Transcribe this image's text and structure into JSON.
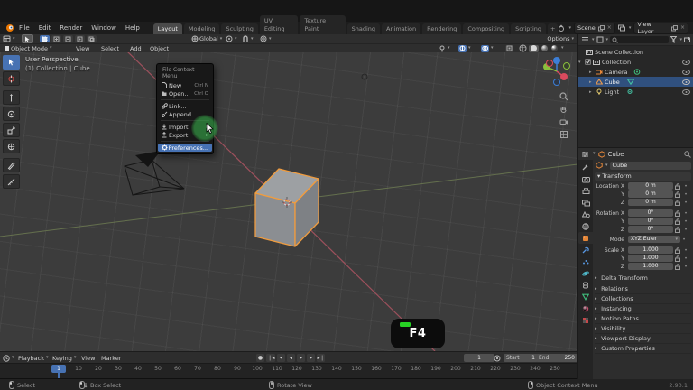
{
  "topbar": {
    "menus": [
      "File",
      "Edit",
      "Render",
      "Window",
      "Help"
    ],
    "tabs": [
      "Layout",
      "Modeling",
      "Sculpting",
      "UV Editing",
      "Texture Paint",
      "Shading",
      "Animation",
      "Rendering",
      "Compositing",
      "Scripting"
    ],
    "add_tab": "+",
    "scene": {
      "label": "Scene"
    },
    "view_layer": {
      "label": "View Layer"
    }
  },
  "tool_settings": {
    "orientation": "Global",
    "options_label": "Options"
  },
  "viewport": {
    "header": {
      "mode": "Object Mode",
      "menus": [
        "View",
        "Select",
        "Add",
        "Object"
      ]
    },
    "overlay": {
      "line1": "User Perspective",
      "line2": "(1) Collection | Cube"
    },
    "toolbar_tools": [
      "select-box",
      "cursor",
      "move",
      "rotate",
      "scale",
      "transform",
      "annotate",
      "measure"
    ],
    "keycast": "F4"
  },
  "context_menu": {
    "title": "File Context Menu",
    "items": [
      {
        "label": "New",
        "shortcut": "Ctrl N",
        "icon": "file-icon"
      },
      {
        "label": "Open...",
        "shortcut": "Ctrl O",
        "icon": "folder-icon"
      },
      {
        "label": "Link...",
        "icon": "link-icon"
      },
      {
        "label": "Append...",
        "icon": "append-icon"
      },
      {
        "label": "Import",
        "submenu": "▸",
        "icon": "import-icon"
      },
      {
        "label": "Export",
        "submenu": "▸",
        "icon": "export-icon"
      },
      {
        "label": "Preferences...",
        "icon": "gear-icon",
        "highlighted": true
      }
    ]
  },
  "outliner": {
    "rows": [
      {
        "label": "Scene Collection"
      },
      {
        "label": "Collection"
      },
      {
        "label": "Camera"
      },
      {
        "label": "Cube",
        "selected": true
      },
      {
        "label": "Light"
      }
    ]
  },
  "properties": {
    "breadcrumb": "Cube",
    "name_field": "Cube",
    "tabs": [
      "tool",
      "render",
      "output",
      "view-layer",
      "scene",
      "world",
      "object",
      "modifiers",
      "particles",
      "physics",
      "constraints",
      "object-data",
      "material",
      "texture"
    ],
    "transform": {
      "header": "Transform",
      "rows": [
        {
          "label": "Location X",
          "value": "0 m"
        },
        {
          "label": "Y",
          "value": "0 m"
        },
        {
          "label": "Z",
          "value": "0 m"
        },
        {
          "label": "Rotation X",
          "value": "0°"
        },
        {
          "label": "Y",
          "value": "0°"
        },
        {
          "label": "Z",
          "value": "0°"
        },
        {
          "label": "Mode",
          "value": "XYZ Euler"
        },
        {
          "label": "Scale X",
          "value": "1.000"
        },
        {
          "label": "Y",
          "value": "1.000"
        },
        {
          "label": "Z",
          "value": "1.000"
        }
      ]
    },
    "panels": [
      "Delta Transform",
      "Relations",
      "Collections",
      "Instancing",
      "Motion Paths",
      "Visibility",
      "Viewport Display",
      "Custom Properties"
    ]
  },
  "timeline": {
    "menus": [
      "Playback",
      "Keying",
      "View",
      "Marker"
    ],
    "current_frame": "1",
    "start_label": "Start",
    "start_value": "1",
    "end_label": "End",
    "end_value": "250",
    "ticks": [
      1,
      10,
      20,
      30,
      40,
      50,
      60,
      70,
      80,
      90,
      100,
      110,
      120,
      130,
      140,
      150,
      160,
      170,
      180,
      190,
      200,
      210,
      220,
      230,
      240,
      250
    ]
  },
  "statusbar": {
    "hints": [
      {
        "label": "Select"
      },
      {
        "label": "Box Select"
      },
      {
        "label": "Rotate View"
      },
      {
        "label": "Object Context Menu"
      }
    ],
    "version": "2.90.1"
  },
  "colors": {
    "accent": "#4772b3",
    "selection_orange": "#f09c3f",
    "keycast_green": "#27d224"
  }
}
